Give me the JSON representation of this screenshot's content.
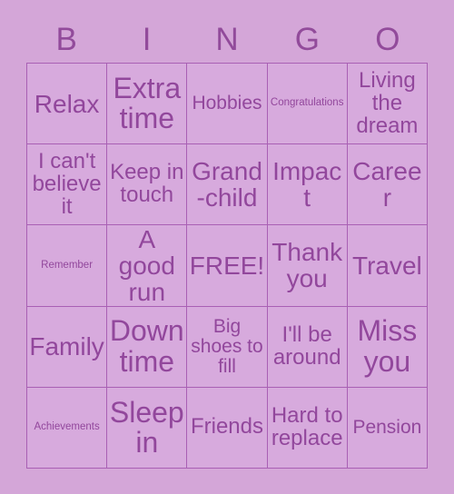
{
  "card": {
    "title_letters": [
      "B",
      "I",
      "N",
      "G",
      "O"
    ],
    "colors": {
      "page_background": "#d4a6d8",
      "cell_background": "#d7aadd",
      "grid_line": "#a960b4",
      "text": "#92479c"
    },
    "grid": {
      "columns": 5,
      "rows": 5,
      "free_space": "FREE!"
    },
    "cells": [
      [
        {
          "text": "Relax",
          "size": "lg"
        },
        {
          "text": "Extra time",
          "size": "xl"
        },
        {
          "text": "Hobbies",
          "size": "sm"
        },
        {
          "text": "Congratulations",
          "size": "tiny"
        },
        {
          "text": "Living the dream",
          "size": "md"
        }
      ],
      [
        {
          "text": "I can't believe it",
          "size": "md"
        },
        {
          "text": "Keep in touch",
          "size": "md"
        },
        {
          "text": "Grand-child",
          "size": "lg"
        },
        {
          "text": "Impact",
          "size": "lg"
        },
        {
          "text": "Career",
          "size": "lg"
        }
      ],
      [
        {
          "text": "Remember",
          "size": "tiny"
        },
        {
          "text": "A good run",
          "size": "lg"
        },
        {
          "text": "FREE!",
          "size": "lg"
        },
        {
          "text": "Thank you",
          "size": "lg"
        },
        {
          "text": "Travel",
          "size": "lg"
        }
      ],
      [
        {
          "text": "Family",
          "size": "lg"
        },
        {
          "text": "Down time",
          "size": "xl"
        },
        {
          "text": "Big shoes to fill",
          "size": "sm"
        },
        {
          "text": "I'll be around",
          "size": "md"
        },
        {
          "text": "Miss you",
          "size": "xl"
        }
      ],
      [
        {
          "text": "Achievements",
          "size": "tiny"
        },
        {
          "text": "Sleep in",
          "size": "xl"
        },
        {
          "text": "Friends",
          "size": "md"
        },
        {
          "text": "Hard to replace",
          "size": "md"
        },
        {
          "text": "Pension",
          "size": "sm"
        }
      ]
    ]
  }
}
